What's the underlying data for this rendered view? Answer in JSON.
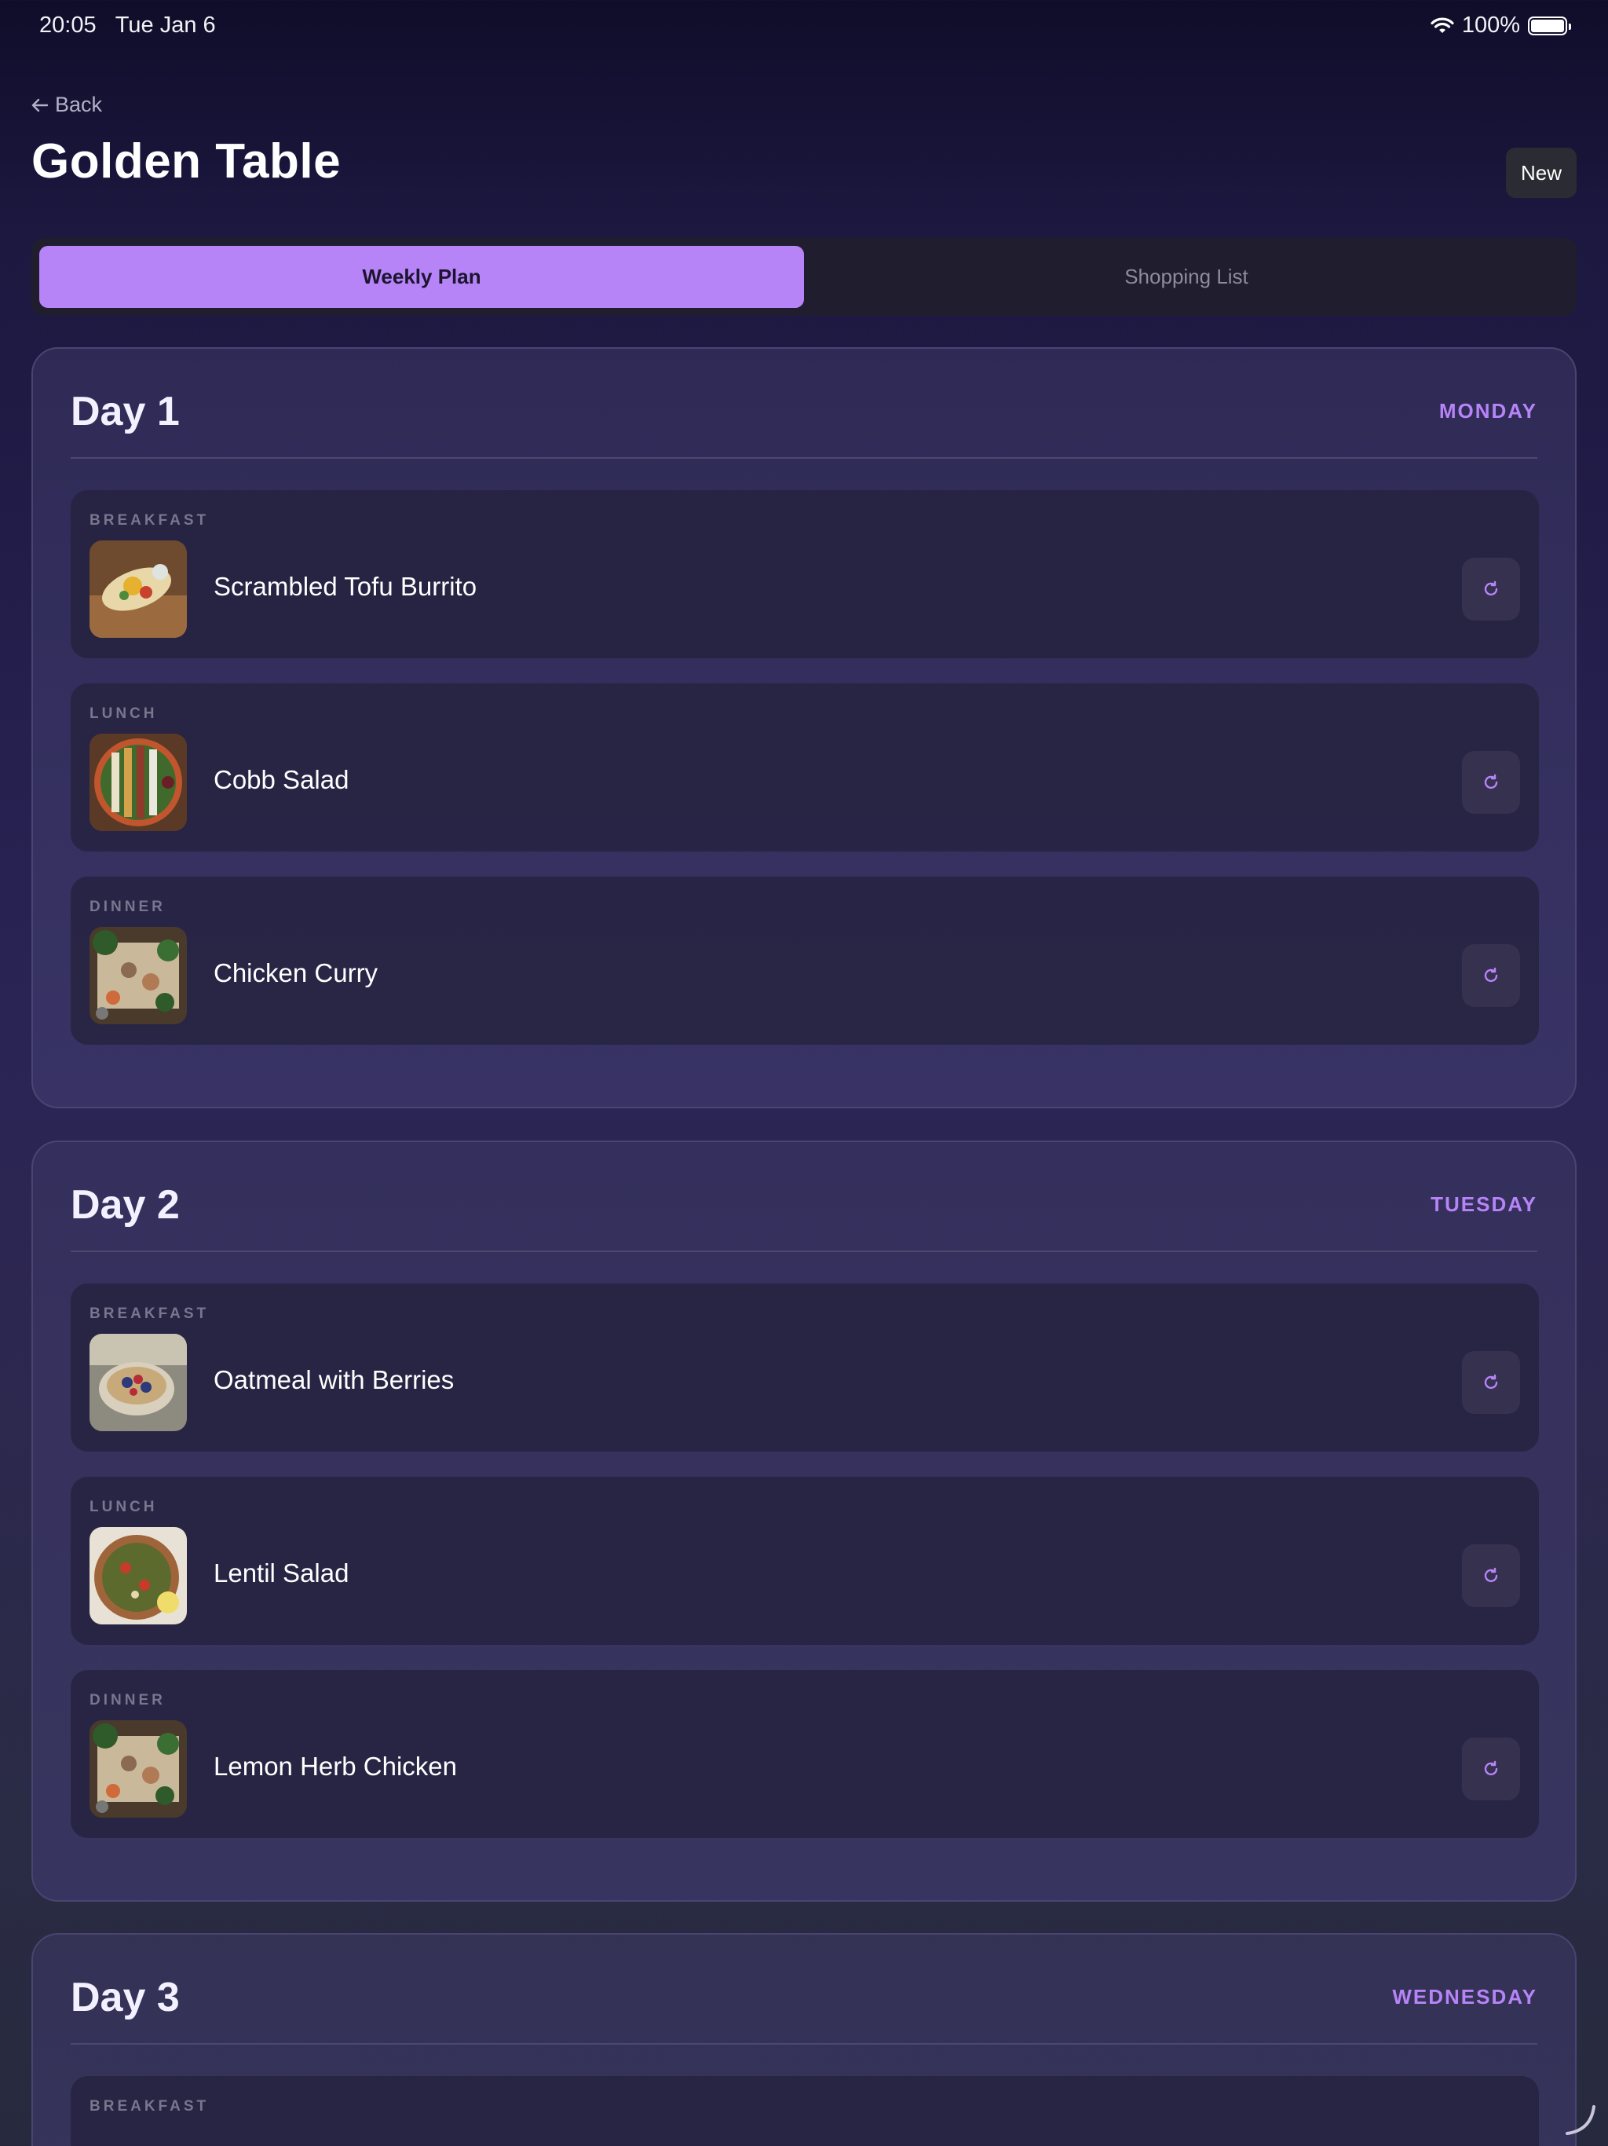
{
  "status_bar": {
    "time": "20:05",
    "date": "Tue Jan 6",
    "battery": "100%"
  },
  "header": {
    "back_label": "Back",
    "title": "Golden Table",
    "new_label": "New"
  },
  "tabs": [
    {
      "label": "Weekly Plan",
      "active": true
    },
    {
      "label": "Shopping List",
      "active": false
    }
  ],
  "days": [
    {
      "title": "Day 1",
      "weekday": "MONDAY",
      "meals": [
        {
          "type": "BREAKFAST",
          "name": "Scrambled Tofu Burrito"
        },
        {
          "type": "LUNCH",
          "name": "Cobb Salad"
        },
        {
          "type": "DINNER",
          "name": "Chicken Curry"
        }
      ]
    },
    {
      "title": "Day 2",
      "weekday": "TUESDAY",
      "meals": [
        {
          "type": "BREAKFAST",
          "name": "Oatmeal with Berries"
        },
        {
          "type": "LUNCH",
          "name": "Lentil Salad"
        },
        {
          "type": "DINNER",
          "name": "Lemon Herb Chicken"
        }
      ]
    },
    {
      "title": "Day 3",
      "weekday": "WEDNESDAY",
      "meals": [
        {
          "type": "BREAKFAST",
          "name": ""
        }
      ]
    }
  ],
  "colors": {
    "accent": "#b784f8",
    "background": "#1c1840",
    "card": "#3a3565"
  },
  "icons": {
    "swap": "refresh-icon",
    "back": "arrow-left-icon",
    "wifi": "wifi-icon",
    "battery": "battery-icon"
  }
}
